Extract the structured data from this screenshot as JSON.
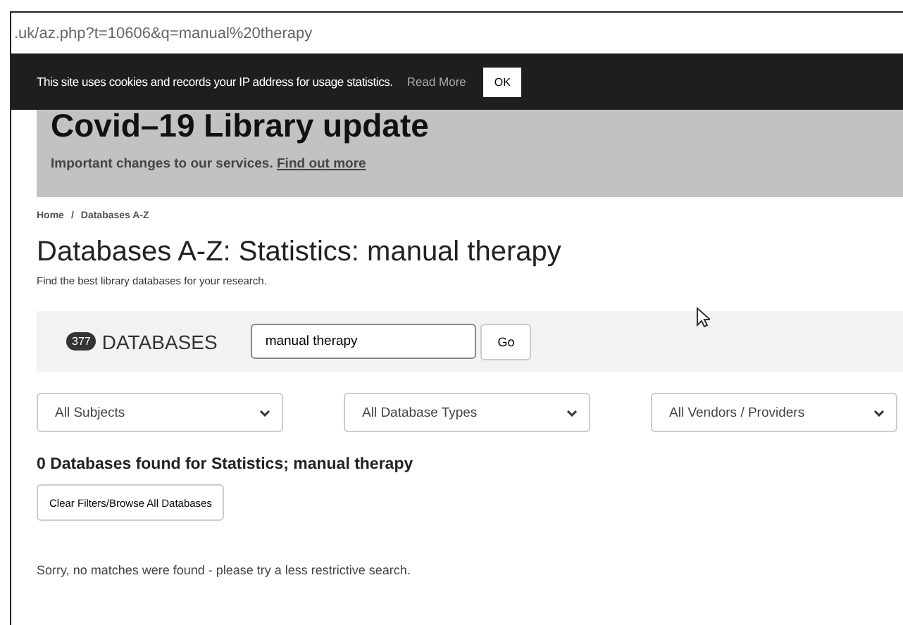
{
  "address_bar": {
    "url": ".uk/az.php?t=10606&q=manual%20therapy"
  },
  "cookie_bar": {
    "message": "This site uses cookies and records your IP address for usage statistics.",
    "link": "Read More",
    "button": "OK"
  },
  "banner": {
    "title": "Covid–19 Library update",
    "text": "Important changes to our services.",
    "link": "Find out more"
  },
  "breadcrumb": [
    "Home",
    "/",
    "Databases A-Z"
  ],
  "page": {
    "title": "Databases A-Z: Statistics: manual therapy",
    "subtitle": "Find the best library databases for your research."
  },
  "search": {
    "count": "377",
    "label": "DATABASES",
    "value": "manual therapy",
    "button": "Go"
  },
  "filters": [
    {
      "value": "All Subjects"
    },
    {
      "value": "All Database Types"
    },
    {
      "value": "All Vendors / Providers"
    }
  ],
  "results": {
    "heading": "0 Databases found for Statistics; manual therapy",
    "clear_button": "Clear Filters/Browse All Databases",
    "message": "Sorry, no matches were found - please try a less restrictive search."
  }
}
